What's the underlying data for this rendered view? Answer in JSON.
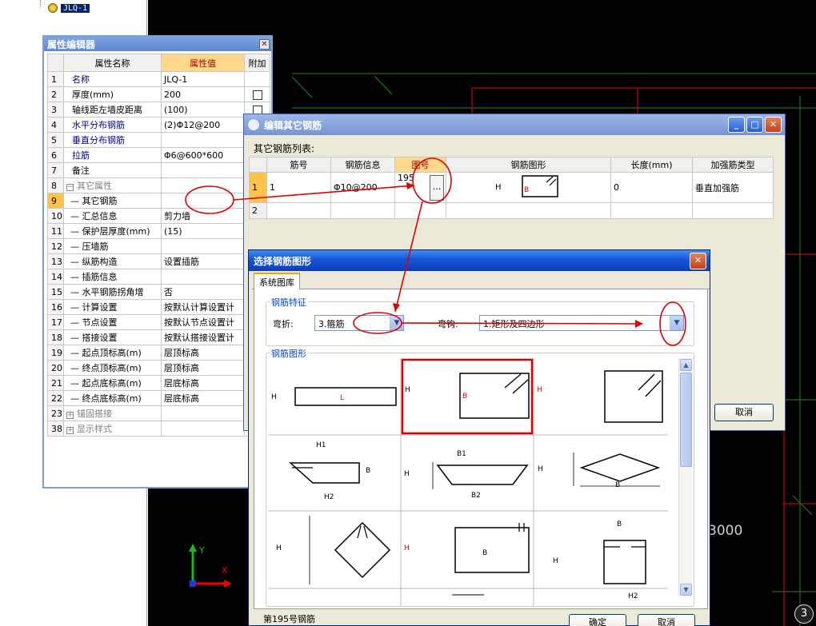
{
  "tree": {
    "node_label": "JLQ-1"
  },
  "cad": {
    "dimension": "3000",
    "corner_number": "3"
  },
  "prop_editor": {
    "title": "属性编辑器",
    "close": "✕",
    "headers": [
      "",
      "属性名称",
      "属性值",
      "附加"
    ],
    "rows": [
      {
        "num": "1",
        "name": "名称",
        "value": "JLQ-1",
        "check": false
      },
      {
        "num": "2",
        "name": "厚度(mm)",
        "value": "200",
        "check": true
      },
      {
        "num": "3",
        "name": "轴线距左墙皮距离",
        "value": "(100)",
        "check": true
      },
      {
        "num": "4",
        "name": "水平分布钢筋",
        "value": "(2)Φ12@200",
        "check": false
      },
      {
        "num": "5",
        "name": "垂直分布钢筋",
        "value": "",
        "check": false
      },
      {
        "num": "6",
        "name": "拉筋",
        "value": "Φ6@600*600",
        "check": false
      },
      {
        "num": "7",
        "name": "备注",
        "value": "",
        "check": false
      },
      {
        "num": "8",
        "name": "其它属性",
        "value": "",
        "check": false
      },
      {
        "num": "9",
        "name": "其它钢筋",
        "value": "",
        "check": false
      },
      {
        "num": "10",
        "name": "汇总信息",
        "value": "剪力墙",
        "check": false
      },
      {
        "num": "11",
        "name": "保护层厚度(mm)",
        "value": "(15)",
        "check": false
      },
      {
        "num": "12",
        "name": "压墙筋",
        "value": "",
        "check": false
      },
      {
        "num": "13",
        "name": "纵筋构造",
        "value": "设置插筋",
        "check": false
      },
      {
        "num": "14",
        "name": "插筋信息",
        "value": "",
        "check": false
      },
      {
        "num": "15",
        "name": "水平钢筋拐角增",
        "value": "否",
        "check": false
      },
      {
        "num": "16",
        "name": "计算设置",
        "value": "按默认计算设置计",
        "check": false
      },
      {
        "num": "17",
        "name": "节点设置",
        "value": "按默认节点设置计",
        "check": false
      },
      {
        "num": "18",
        "name": "搭接设置",
        "value": "按默认搭接设置计",
        "check": false
      },
      {
        "num": "19",
        "name": "起点顶标高(m)",
        "value": "层顶标高",
        "check": false
      },
      {
        "num": "20",
        "name": "终点顶标高(m)",
        "value": "层顶标高",
        "check": false
      },
      {
        "num": "21",
        "name": "起点底标高(m)",
        "value": "层底标高",
        "check": false
      },
      {
        "num": "22",
        "name": "终点底标高(m)",
        "value": "层底标高",
        "check": false
      },
      {
        "num": "23",
        "name": "锚固搭接",
        "value": "",
        "check": false
      },
      {
        "num": "38",
        "name": "显示样式",
        "value": "",
        "check": false
      }
    ]
  },
  "rebar_win": {
    "title": "编辑其它钢筋",
    "list_label": "其它钢筋列表:",
    "headers": [
      "",
      "筋号",
      "钢筋信息",
      "图号",
      "钢筋图形",
      "长度(mm)",
      "加强筋类型"
    ],
    "row1": {
      "num": "1",
      "bar_no": "1",
      "info": "Φ10@200",
      "fig_no": "195",
      "len": "0",
      "type": "垂直加强筋",
      "ellipsis": "..."
    },
    "row2": {
      "num": "2"
    },
    "cancel": "取消",
    "btn_min": "_",
    "btn_max": "□",
    "btn_close": "✕"
  },
  "shape_dlg": {
    "title": "选择钢筋图形",
    "tab": "系统图库",
    "feature_group": "钢筋特征",
    "bend_label": "弯折:",
    "bend_value": "3.箍筋",
    "hook_label": "弯钩:",
    "hook_value": "1.矩形及四边形",
    "shape_group": "钢筋图形",
    "status": "第195号钢筋",
    "ok": "确定",
    "cancel": "取消",
    "close": "✕",
    "labels": {
      "H": "H",
      "L": "L",
      "B": "B",
      "H1": "H1",
      "H2": "H2",
      "B1": "B1",
      "B2": "B2"
    }
  },
  "colors": {
    "highlight_header": "#ffd889",
    "selected_row": "#ffc34a",
    "annotation_red": "#e00000",
    "title_blue": "#1855d8"
  }
}
